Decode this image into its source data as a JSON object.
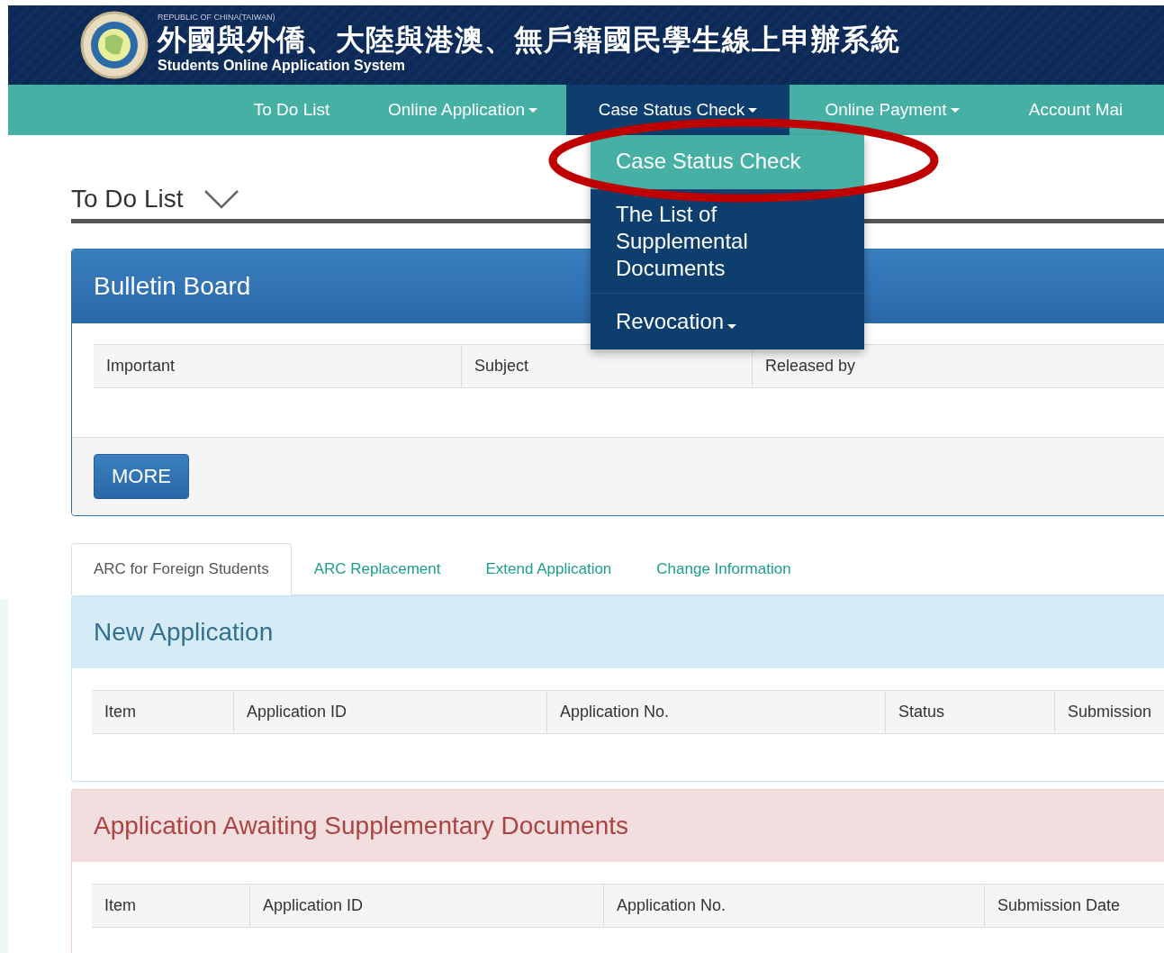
{
  "header": {
    "country": "REPUBLIC OF CHINA(TAIWAN)",
    "title": "外國與外僑、大陸與港澳、無戶籍國民學生線上申辦系統",
    "subtitle": "Students Online Application System"
  },
  "nav": [
    {
      "label": "To Do List",
      "caret": false,
      "selected": false
    },
    {
      "label": "Online Application",
      "caret": true,
      "selected": false
    },
    {
      "label": "Case Status Check",
      "caret": true,
      "selected": true
    },
    {
      "label": "Online Payment",
      "caret": true,
      "selected": false
    },
    {
      "label": "Account Mai",
      "caret": false,
      "selected": false
    }
  ],
  "dropdown": [
    {
      "label": "Case Status Check",
      "caret": false,
      "selected": true
    },
    {
      "label": "The List of Supplemental Documents",
      "caret": false,
      "selected": false
    },
    {
      "label": "Revocation",
      "caret": true,
      "selected": false
    }
  ],
  "page_title": "To Do List",
  "bulletin": {
    "title": "Bulletin Board",
    "columns": [
      "Important",
      "Subject",
      "Released by"
    ],
    "more_button": "MORE"
  },
  "tabs": [
    {
      "label": "ARC for Foreign Students",
      "selected": true
    },
    {
      "label": "ARC Replacement",
      "selected": false
    },
    {
      "label": "Extend Application",
      "selected": false
    },
    {
      "label": "Change Information",
      "selected": false
    }
  ],
  "panels": [
    {
      "kind": "info",
      "title": "New Application",
      "columns": [
        "Item",
        "Application ID",
        "Application No.",
        "Status",
        "Submission"
      ]
    },
    {
      "kind": "danger",
      "title": "Application Awaiting Supplementary Documents",
      "columns": [
        "Item",
        "Application ID",
        "Application No.",
        "Submission Date"
      ]
    }
  ]
}
